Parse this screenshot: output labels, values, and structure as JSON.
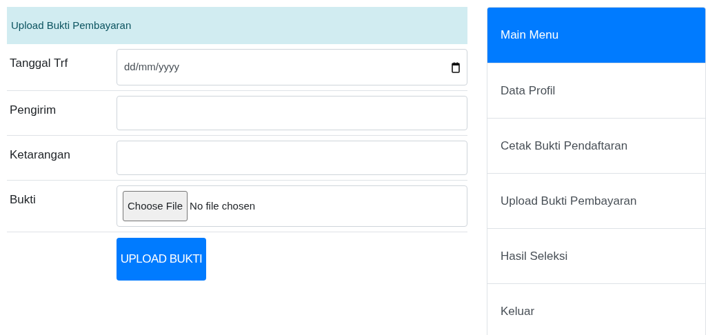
{
  "form": {
    "title": "Upload Bukti Pembayaran",
    "fields": [
      {
        "kind": "date",
        "label": "Tanggal Trf",
        "placeholder": "dd/mm/yyyy"
      },
      {
        "kind": "text",
        "label": "Pengirim"
      },
      {
        "kind": "text",
        "label": "Ketarangan"
      },
      {
        "kind": "file",
        "label": "Bukti",
        "button": "Choose File",
        "status": "No file chosen"
      }
    ],
    "submit": "UPLOAD BUKTI"
  },
  "menu": {
    "items": [
      {
        "label": "Main Menu",
        "selected": true
      },
      {
        "label": "Data Profil",
        "selected": false
      },
      {
        "label": "Cetak Bukti Pendaftaran",
        "selected": false
      },
      {
        "label": "Upload Bukti Pembayaran",
        "selected": false
      },
      {
        "label": "Hasil Seleksi",
        "selected": false
      },
      {
        "label": "Keluar",
        "selected": false
      }
    ]
  }
}
